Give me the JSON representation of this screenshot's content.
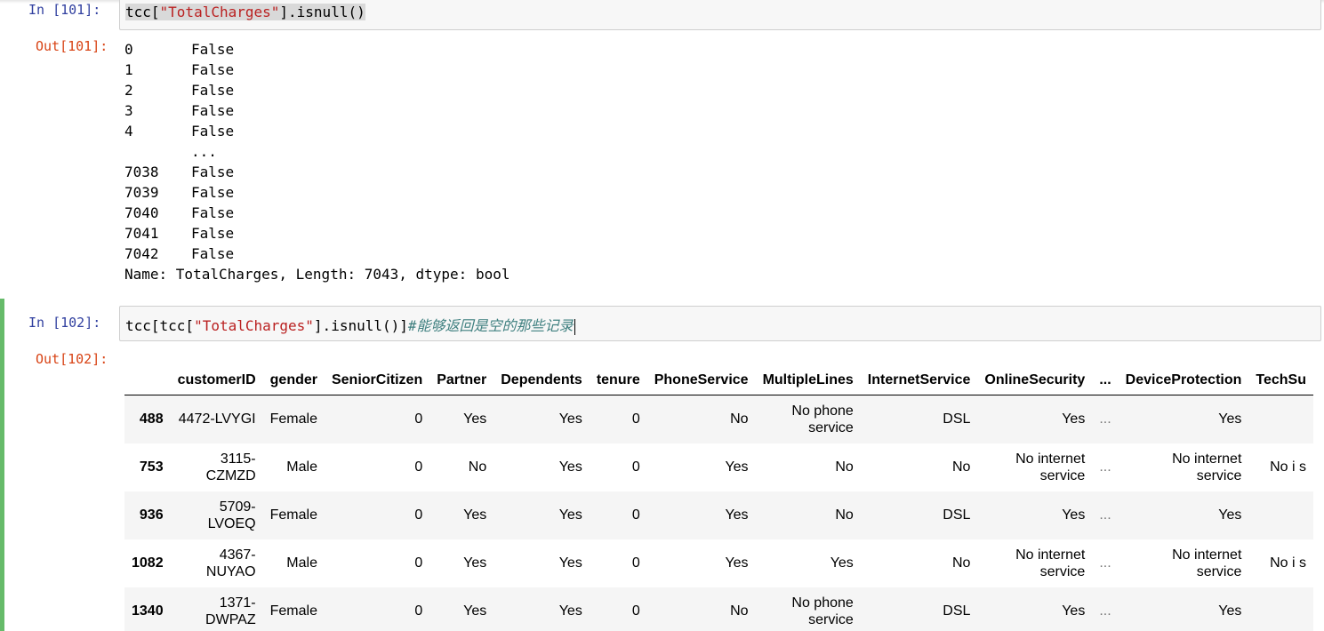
{
  "cell1": {
    "in_prompt": "In  [101]:",
    "out_prompt": "Out[101]:",
    "code": {
      "pre": "tcc[",
      "str": "\"TotalCharges\"",
      "post": "].isnull()"
    },
    "series_rows": [
      {
        "idx": "0",
        "val": "False"
      },
      {
        "idx": "1",
        "val": "False"
      },
      {
        "idx": "2",
        "val": "False"
      },
      {
        "idx": "3",
        "val": "False"
      },
      {
        "idx": "4",
        "val": "False"
      },
      {
        "idx": "",
        "val": "..."
      },
      {
        "idx": "7038",
        "val": "False"
      },
      {
        "idx": "7039",
        "val": "False"
      },
      {
        "idx": "7040",
        "val": "False"
      },
      {
        "idx": "7041",
        "val": "False"
      },
      {
        "idx": "7042",
        "val": "False"
      }
    ],
    "series_footer": "Name: TotalCharges, Length: 7043, dtype: bool"
  },
  "cell2": {
    "in_prompt": "In  [102]:",
    "out_prompt": "Out[102]:",
    "code": {
      "pre": "tcc[tcc[",
      "str": "\"TotalCharges\"",
      "post": "].isnull()]",
      "comment": "#能够返回是空的那些记录"
    },
    "table": {
      "columns": [
        "",
        "customerID",
        "gender",
        "SeniorCitizen",
        "Partner",
        "Dependents",
        "tenure",
        "PhoneService",
        "MultipleLines",
        "InternetService",
        "OnlineSecurity",
        "...",
        "DeviceProtection",
        "TechSu"
      ],
      "rows": [
        {
          "index": "488",
          "cells": [
            "4472-LVYGI",
            "Female",
            "0",
            "Yes",
            "Yes",
            "0",
            "No",
            "No phone service",
            "DSL",
            "Yes",
            "...",
            "Yes",
            ""
          ]
        },
        {
          "index": "753",
          "cells": [
            "3115-CZMZD",
            "Male",
            "0",
            "No",
            "Yes",
            "0",
            "Yes",
            "No",
            "No",
            "No internet service",
            "...",
            "No internet service",
            "No i s"
          ]
        },
        {
          "index": "936",
          "cells": [
            "5709-LVOEQ",
            "Female",
            "0",
            "Yes",
            "Yes",
            "0",
            "Yes",
            "No",
            "DSL",
            "Yes",
            "...",
            "Yes",
            ""
          ]
        },
        {
          "index": "1082",
          "cells": [
            "4367-NUYAO",
            "Male",
            "0",
            "Yes",
            "Yes",
            "0",
            "Yes",
            "Yes",
            "No",
            "No internet service",
            "...",
            "No internet service",
            "No i s"
          ]
        },
        {
          "index": "1340",
          "cells": [
            "1371-DWPAZ",
            "Female",
            "0",
            "Yes",
            "Yes",
            "0",
            "No",
            "No phone service",
            "DSL",
            "Yes",
            "...",
            "Yes",
            ""
          ]
        }
      ]
    }
  }
}
